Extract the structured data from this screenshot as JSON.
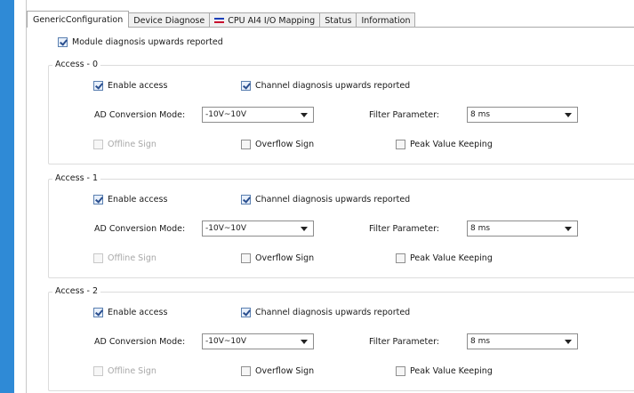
{
  "tabs": [
    {
      "label": "GenericConfiguration",
      "active": true
    },
    {
      "label": "Device Diagnose",
      "active": false
    },
    {
      "label": "CPU AI4 I/O Mapping",
      "active": false,
      "icon": "io-mapping-icon"
    },
    {
      "label": "Status",
      "active": false
    },
    {
      "label": "Information",
      "active": false
    }
  ],
  "module_diag": {
    "label": "Module diagnosis upwards reported",
    "checked": true
  },
  "groups": [
    {
      "title": "Access - 0",
      "enable_access": "Enable access",
      "channel_diag": "Channel diagnosis upwards reported",
      "ad_label": "AD Conversion Mode:",
      "ad_value": "-10V~10V",
      "filter_label": "Filter Parameter:",
      "filter_value": "8 ms",
      "offline": "Offline Sign",
      "overflow": "Overflow Sign",
      "peak": "Peak Value Keeping"
    },
    {
      "title": "Access - 1",
      "enable_access": "Enable access",
      "channel_diag": "Channel diagnosis upwards reported",
      "ad_label": "AD Conversion Mode:",
      "ad_value": "-10V~10V",
      "filter_label": "Filter Parameter:",
      "filter_value": "8 ms",
      "offline": "Offline Sign",
      "overflow": "Overflow Sign",
      "peak": "Peak Value Keeping"
    },
    {
      "title": "Access - 2",
      "enable_access": "Enable access",
      "channel_diag": "Channel diagnosis upwards reported",
      "ad_label": "AD Conversion Mode:",
      "ad_value": "-10V~10V",
      "filter_label": "Filter Parameter:",
      "filter_value": "8 ms",
      "offline": "Offline Sign",
      "overflow": "Overflow Sign",
      "peak": "Peak Value Keeping"
    }
  ],
  "colors": {
    "accent_strip": "#2f8ad6",
    "checkbox_check": "#2a4f8f"
  }
}
